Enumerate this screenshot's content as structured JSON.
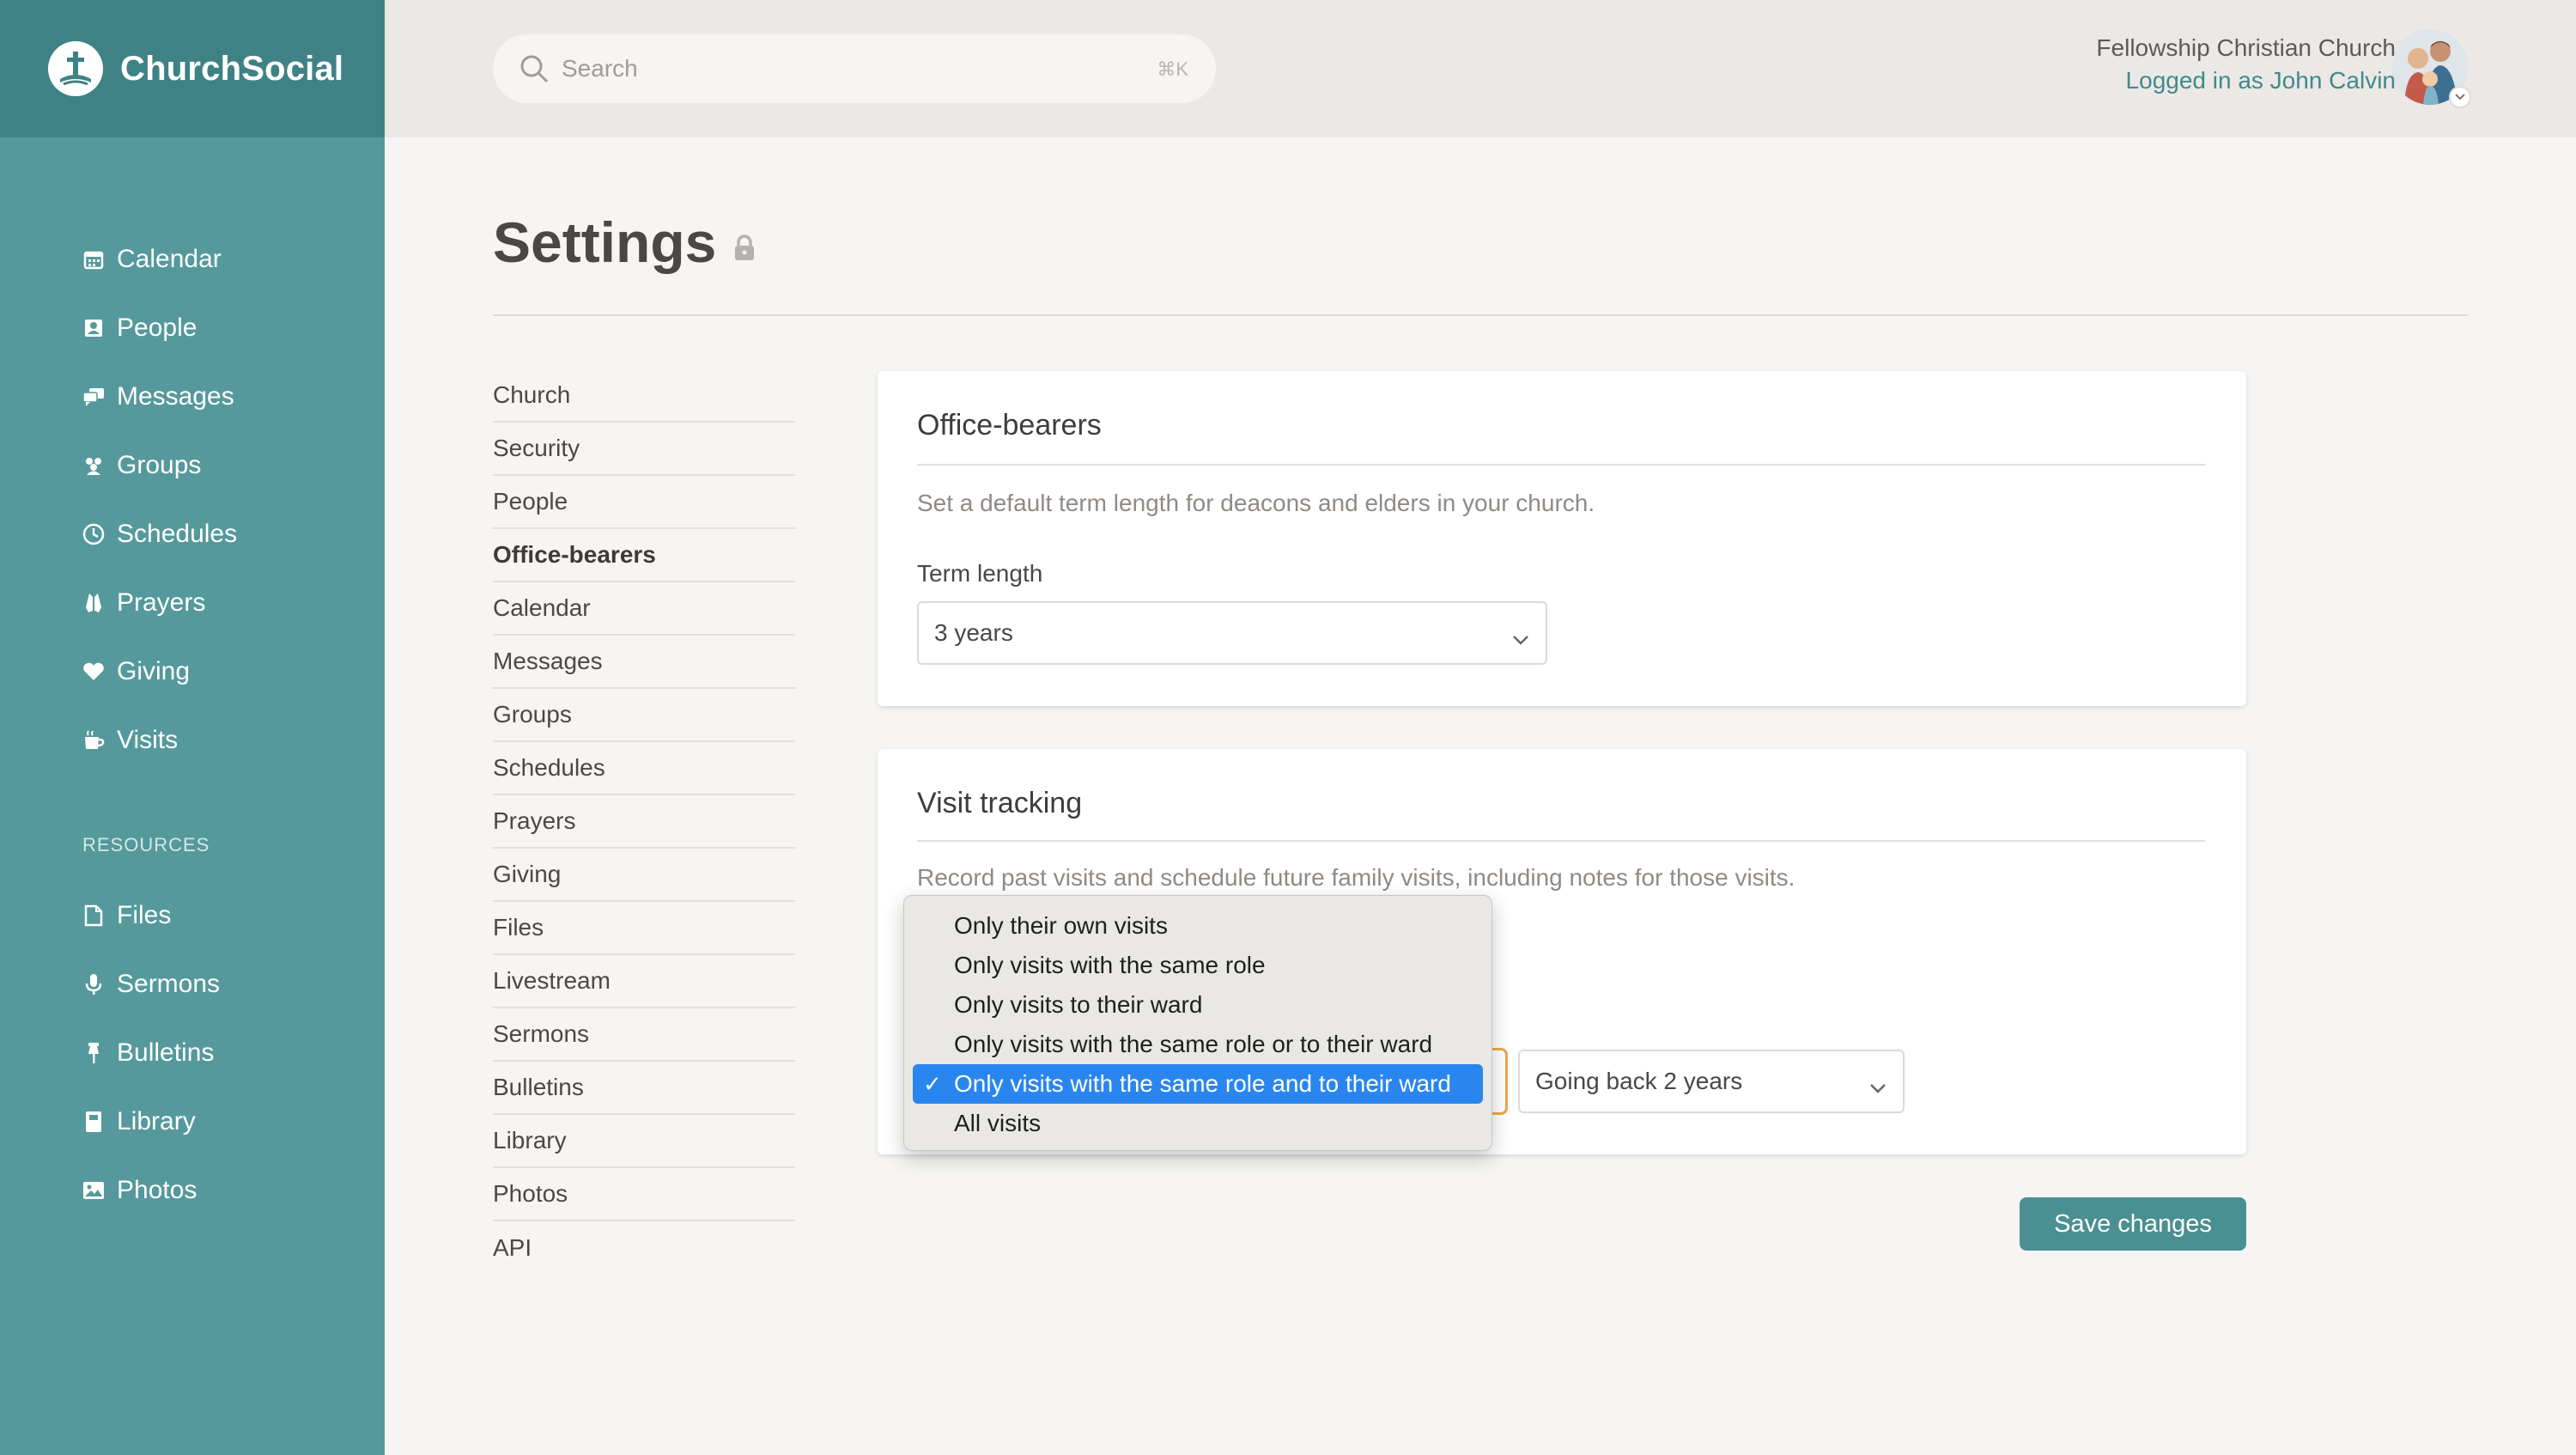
{
  "app": {
    "name": "ChurchSocial"
  },
  "sidebar": {
    "items": [
      {
        "label": "Calendar",
        "icon": "calendar-icon"
      },
      {
        "label": "People",
        "icon": "people-icon"
      },
      {
        "label": "Messages",
        "icon": "messages-icon"
      },
      {
        "label": "Groups",
        "icon": "groups-icon"
      },
      {
        "label": "Schedules",
        "icon": "clock-icon"
      },
      {
        "label": "Prayers",
        "icon": "praying-hands-icon"
      },
      {
        "label": "Giving",
        "icon": "heart-icon"
      },
      {
        "label": "Visits",
        "icon": "cup-icon"
      }
    ],
    "resources_label": "RESOURCES",
    "resources": [
      {
        "label": "Files",
        "icon": "file-icon"
      },
      {
        "label": "Sermons",
        "icon": "microphone-icon"
      },
      {
        "label": "Bulletins",
        "icon": "pin-icon"
      },
      {
        "label": "Library",
        "icon": "book-icon"
      },
      {
        "label": "Photos",
        "icon": "image-icon"
      }
    ]
  },
  "header": {
    "search_placeholder": "Search",
    "search_shortcut": "⌘K",
    "church_name": "Fellowship Christian Church",
    "logged_in": "Logged in as John Calvin"
  },
  "page": {
    "title": "Settings"
  },
  "settings_nav": {
    "items": [
      "Church",
      "Security",
      "People",
      "Office-bearers",
      "Calendar",
      "Messages",
      "Groups",
      "Schedules",
      "Prayers",
      "Giving",
      "Files",
      "Livestream",
      "Sermons",
      "Bulletins",
      "Library",
      "Photos",
      "API"
    ],
    "active": "Office-bearers"
  },
  "office_bearers": {
    "title": "Office-bearers",
    "description": "Set a default term length for deacons and elders in your church.",
    "term_label": "Term length",
    "term_value": "3 years"
  },
  "visit_tracking": {
    "title": "Visit tracking",
    "description": "Record past visits and schedule future family visits, including notes for those visits.",
    "going_back_value": "Going back 2 years"
  },
  "dropdown": {
    "options": [
      "Only their own visits",
      "Only visits with the same role",
      "Only visits to their ward",
      "Only visits with the same role or to their ward",
      "Only visits with the same role and to their ward",
      "All visits"
    ],
    "selected_index": 4,
    "check_mark": "✓"
  },
  "actions": {
    "save_label": "Save changes"
  },
  "colors": {
    "sidebar": "#55999c",
    "brand_bar": "#3f8285",
    "accent": "#4a8f92",
    "selected_option": "#2a86ef",
    "focus_ring": "#f0a64b"
  }
}
